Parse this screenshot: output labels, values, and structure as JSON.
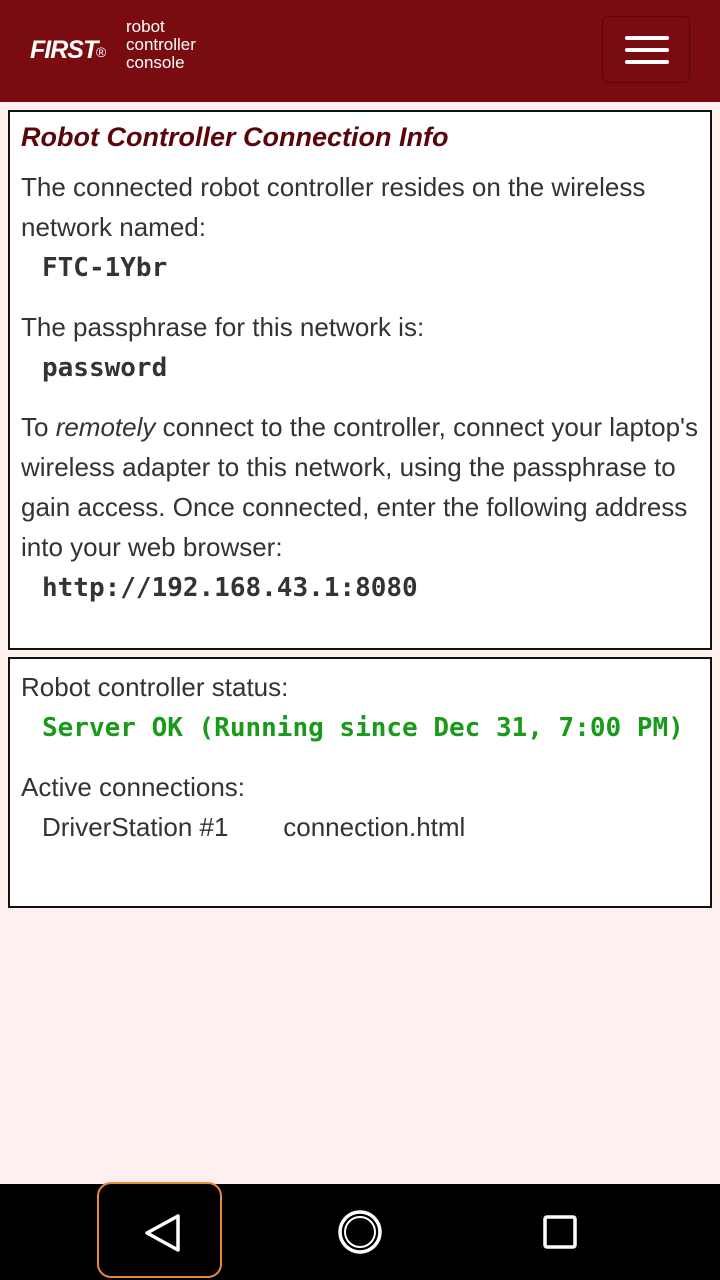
{
  "header": {
    "logo_word": "FIRST",
    "logo_reg": "®",
    "tagline": [
      "robot",
      "controller",
      "console"
    ],
    "menu_icon": "hamburger-menu-icon"
  },
  "connection_info": {
    "title": "Robot Controller Connection Info",
    "network_intro": "The connected robot controller resides on the wireless network named:",
    "network_name": "FTC-1Ybr",
    "passphrase_intro": "The passphrase for this network is:",
    "passphrase": "password",
    "remote_prefix": "To ",
    "remote_em": "remotely",
    "remote_suffix": " connect to the controller, connect your laptop's wireless adapter to this network, using the passphrase to gain access. Once connected, enter the following address into your web browser:",
    "address": "http://192.168.43.1:8080"
  },
  "status": {
    "label": "Robot controller status:",
    "value": "Server OK (Running since Dec 31, 7:00 PM)",
    "color": "#1a9a1a",
    "connections_label": "Active connections:",
    "connections": [
      {
        "name": "DriverStation #1",
        "page": "connection.html"
      }
    ]
  },
  "navbar": {
    "back_icon": "back-triangle-icon",
    "home_icon": "home-circle-icon",
    "recent_icon": "recent-apps-square-icon",
    "highlight_color": "#e98a3c"
  },
  "colors": {
    "header_bg": "#7a0c11",
    "page_bg": "#fdf0ee",
    "title_color": "#5a0509"
  }
}
